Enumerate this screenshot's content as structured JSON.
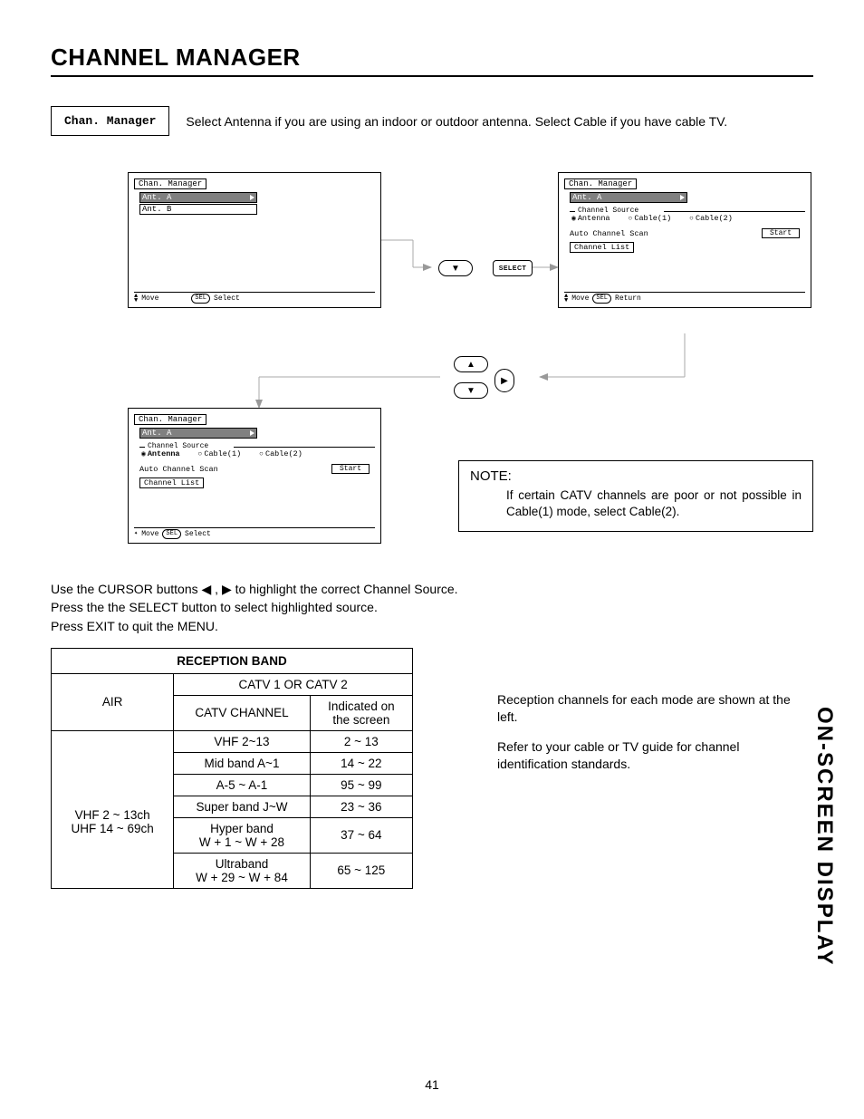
{
  "page": {
    "number": "41",
    "side_label": "ON-SCREEN DISPLAY"
  },
  "heading": "CHANNEL MANAGER",
  "intro": {
    "box": "Chan. Manager",
    "text": "Select Antenna if you are using an indoor or outdoor antenna.  Select Cable if you have cable TV."
  },
  "osd": {
    "title": "Chan. Manager",
    "ant_a": "Ant. A",
    "ant_b": "Ant. B",
    "move": "Move",
    "select": "Select",
    "return": "Return",
    "sel_btn": "SEL",
    "channel_source_label": "Channel Source",
    "radio": {
      "antenna": "Antenna",
      "cable1": "Cable(1)",
      "cable2": "Cable(2)"
    },
    "auto_scan": "Auto Channel Scan",
    "start": "Start",
    "channel_list": "Channel List"
  },
  "remote": {
    "select_label": "SELECT"
  },
  "note": {
    "title": "NOTE:",
    "body": "If certain CATV channels are poor or not possible in Cable(1) mode, select Cable(2)."
  },
  "body_para": {
    "line1_pre": "Use the CURSOR buttons ",
    "line1_post": " to highlight the correct Channel Source.",
    "line2": "Press the the SELECT button to select highlighted source.",
    "line3": "Press EXIT to quit the MENU."
  },
  "table": {
    "header": "RECEPTION BAND",
    "air": "AIR",
    "catv_header": "CATV 1 OR CATV 2",
    "catv_channel": "CATV CHANNEL",
    "indicated_on": "Indicated on",
    "the_screen": "the screen",
    "air_rows": {
      "row1": "VHF 2 ~ 13ch",
      "row2": "UHF 14 ~ 69ch"
    },
    "rows": [
      {
        "ch": "VHF 2~13",
        "ind": "2 ~ 13"
      },
      {
        "ch": "Mid band A~1",
        "ind": "14 ~ 22"
      },
      {
        "ch": "A-5 ~ A-1",
        "ind": "95 ~ 99"
      },
      {
        "ch": "Super band J~W",
        "ind": "23 ~ 36"
      },
      {
        "ch": "Hyper band\nW + 1 ~ W + 28",
        "ind": "37 ~ 64"
      },
      {
        "ch": "Ultraband\nW + 29 ~ W + 84",
        "ind": "65 ~ 125"
      }
    ]
  },
  "side_texts": {
    "t1": "Reception channels for each mode are shown at the left.",
    "t2": "Refer to your cable or TV guide for channel identification standards."
  }
}
